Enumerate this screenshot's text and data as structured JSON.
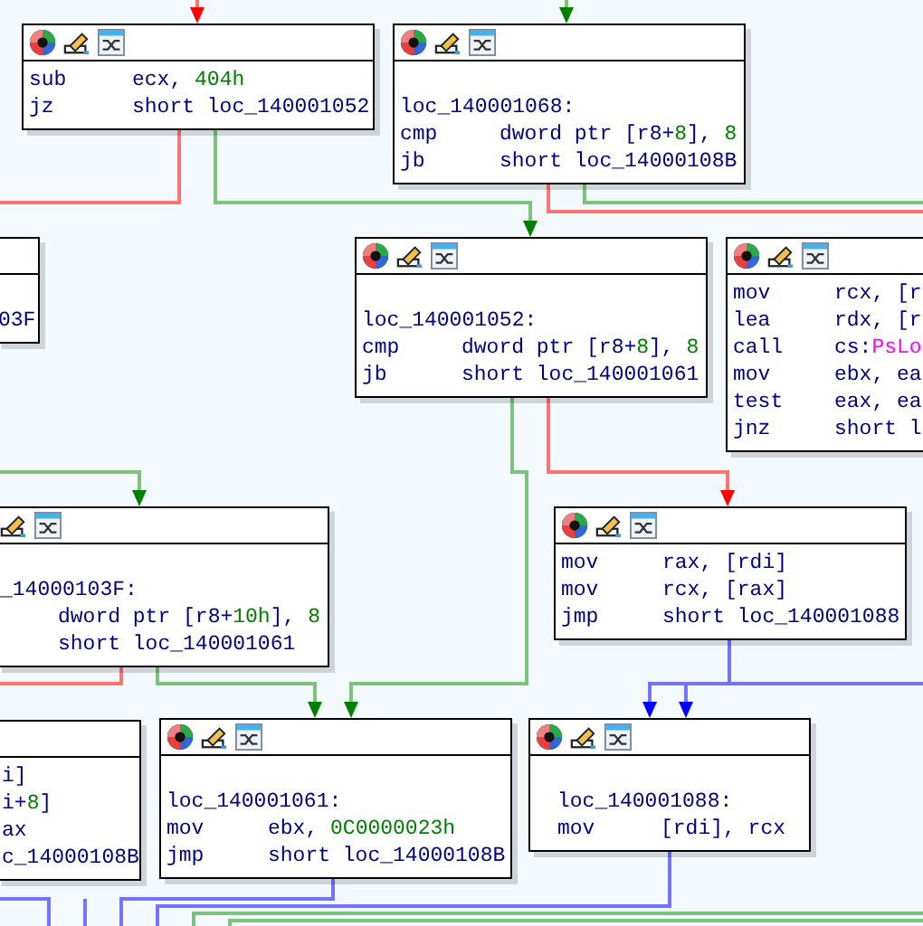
{
  "graph": {
    "blocks": [
      {
        "lines": [
          {
            "kind": "instr",
            "mnemonic": "sub",
            "operands": [
              {
                "text": "ecx, ",
                "kind": "plain"
              },
              {
                "text": "404h",
                "kind": "number"
              }
            ]
          },
          {
            "kind": "instr",
            "mnemonic": "jz",
            "operands": [
              {
                "text": "short loc_140001052",
                "kind": "plain"
              }
            ]
          }
        ]
      },
      {
        "lines": [
          {
            "kind": "blank"
          },
          {
            "kind": "label",
            "text": "loc_140001068:"
          },
          {
            "kind": "instr",
            "mnemonic": "cmp",
            "operands": [
              {
                "text": "dword ptr [r8+",
                "kind": "plain"
              },
              {
                "text": "8",
                "kind": "number"
              },
              {
                "text": "], ",
                "kind": "plain"
              },
              {
                "text": "8",
                "kind": "number"
              }
            ]
          },
          {
            "kind": "instr",
            "mnemonic": "jb",
            "operands": [
              {
                "text": "short loc_14000108B",
                "kind": "plain"
              }
            ]
          }
        ]
      },
      {
        "lines": [
          {
            "kind": "blank"
          },
          {
            "kind": "label",
            "text": "03F"
          }
        ]
      },
      {
        "lines": [
          {
            "kind": "blank"
          },
          {
            "kind": "label",
            "text": "loc_140001052:"
          },
          {
            "kind": "instr",
            "mnemonic": "cmp",
            "operands": [
              {
                "text": "dword ptr [r8+",
                "kind": "plain"
              },
              {
                "text": "8",
                "kind": "number"
              },
              {
                "text": "], ",
                "kind": "plain"
              },
              {
                "text": "8",
                "kind": "number"
              }
            ]
          },
          {
            "kind": "instr",
            "mnemonic": "jb",
            "operands": [
              {
                "text": "short loc_140001061",
                "kind": "plain"
              }
            ]
          }
        ]
      },
      {
        "lines": [
          {
            "kind": "instr",
            "mnemonic": "mov",
            "operands": [
              {
                "text": "rcx, [r",
                "kind": "plain"
              }
            ]
          },
          {
            "kind": "instr",
            "mnemonic": "lea",
            "operands": [
              {
                "text": "rdx, [r",
                "kind": "plain"
              }
            ]
          },
          {
            "kind": "instr",
            "mnemonic": "call",
            "operands": [
              {
                "text": "cs:",
                "kind": "plain"
              },
              {
                "text": "PsLo",
                "kind": "import"
              }
            ]
          },
          {
            "kind": "instr",
            "mnemonic": "mov",
            "operands": [
              {
                "text": "ebx, ea",
                "kind": "plain"
              }
            ]
          },
          {
            "kind": "instr",
            "mnemonic": "test",
            "operands": [
              {
                "text": "eax, ea",
                "kind": "plain"
              }
            ]
          },
          {
            "kind": "instr",
            "mnemonic": "jnz",
            "operands": [
              {
                "text": "short l",
                "kind": "plain"
              }
            ]
          }
        ]
      },
      {
        "lines": [
          {
            "kind": "blank"
          },
          {
            "kind": "label",
            "text": "_14000103F:"
          },
          {
            "kind": "instr",
            "operands": [
              {
                "text": "dword ptr [r8+",
                "kind": "plain"
              },
              {
                "text": "10h",
                "kind": "number"
              },
              {
                "text": "], ",
                "kind": "plain"
              },
              {
                "text": "8",
                "kind": "number"
              }
            ]
          },
          {
            "kind": "instr",
            "operands": [
              {
                "text": "short loc_140001061",
                "kind": "plain"
              }
            ]
          }
        ]
      },
      {
        "lines": [
          {
            "kind": "instr",
            "mnemonic": "mov",
            "operands": [
              {
                "text": "rax, [rdi]",
                "kind": "plain"
              }
            ]
          },
          {
            "kind": "instr",
            "mnemonic": "mov",
            "operands": [
              {
                "text": "rcx, [rax]",
                "kind": "plain"
              }
            ]
          },
          {
            "kind": "instr",
            "mnemonic": "jmp",
            "operands": [
              {
                "text": "short loc_140001088",
                "kind": "plain"
              }
            ]
          }
        ]
      },
      {
        "lines": [
          {
            "kind": "instr",
            "operands": [
              {
                "text": "i]",
                "kind": "plain"
              }
            ]
          },
          {
            "kind": "instr",
            "operands": [
              {
                "text": "i+",
                "kind": "plain"
              },
              {
                "text": "8",
                "kind": "number"
              },
              {
                "text": "]",
                "kind": "plain"
              }
            ]
          },
          {
            "kind": "instr",
            "operands": [
              {
                "text": "ax",
                "kind": "plain"
              }
            ]
          },
          {
            "kind": "instr",
            "operands": [
              {
                "text": "c_14000108B",
                "kind": "plain"
              }
            ]
          }
        ]
      },
      {
        "lines": [
          {
            "kind": "blank"
          },
          {
            "kind": "label",
            "text": "loc_140001061:"
          },
          {
            "kind": "instr",
            "mnemonic": "mov",
            "operands": [
              {
                "text": "ebx, ",
                "kind": "plain"
              },
              {
                "text": "0C0000023h",
                "kind": "number"
              }
            ]
          },
          {
            "kind": "instr",
            "mnemonic": "jmp",
            "operands": [
              {
                "text": "short loc_14000108B",
                "kind": "plain"
              }
            ]
          }
        ]
      },
      {
        "lines": [
          {
            "kind": "blank"
          },
          {
            "kind": "label",
            "text": "loc_140001088:"
          },
          {
            "kind": "instr",
            "mnemonic": "mov",
            "operands": [
              {
                "text": "[rdi], rcx",
                "kind": "plain"
              }
            ]
          }
        ]
      }
    ]
  }
}
